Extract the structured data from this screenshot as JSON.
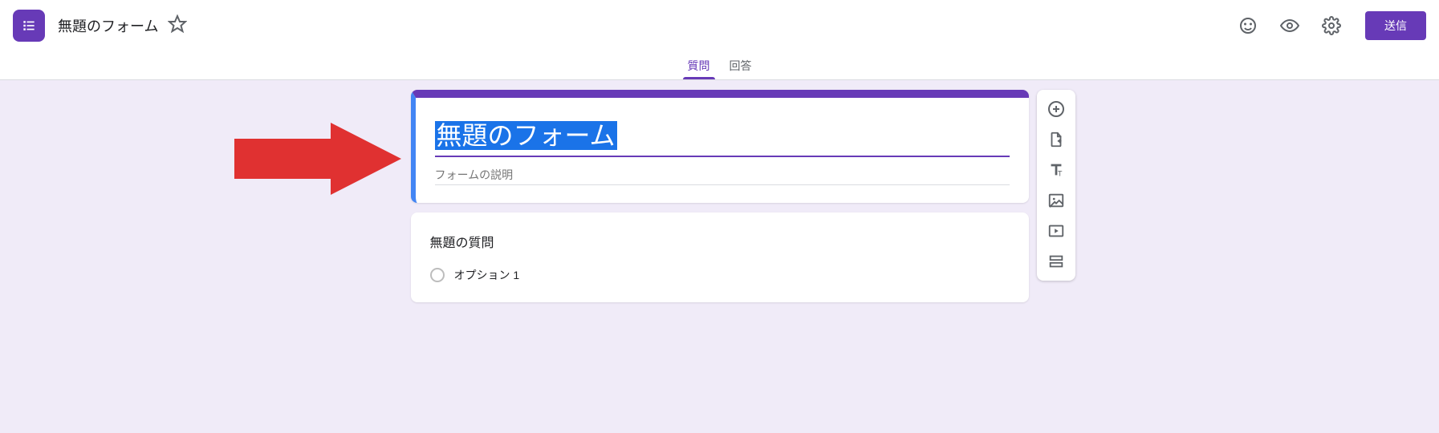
{
  "header": {
    "doc_title": "無題のフォーム",
    "send_label": "送信"
  },
  "tabs": {
    "questions": "質問",
    "responses": "回答"
  },
  "form": {
    "title": "無題のフォーム",
    "desc_placeholder": "フォームの説明",
    "question_title": "無題の質問",
    "option1": "オプション 1"
  }
}
